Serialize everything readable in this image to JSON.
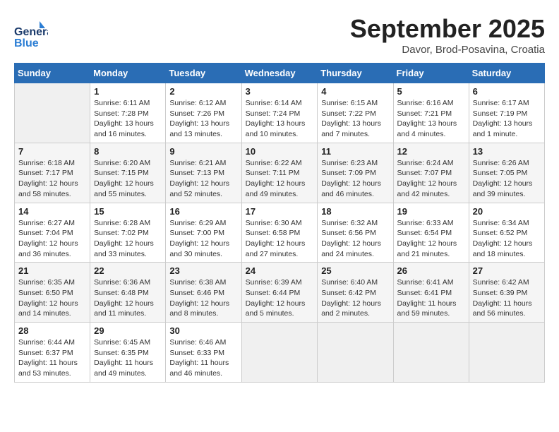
{
  "logo": {
    "general": "General",
    "blue": "Blue"
  },
  "header": {
    "month": "September 2025",
    "location": "Davor, Brod-Posavina, Croatia"
  },
  "days_of_week": [
    "Sunday",
    "Monday",
    "Tuesday",
    "Wednesday",
    "Thursday",
    "Friday",
    "Saturday"
  ],
  "weeks": [
    [
      {
        "day": "",
        "info": ""
      },
      {
        "day": "1",
        "info": "Sunrise: 6:11 AM\nSunset: 7:28 PM\nDaylight: 13 hours\nand 16 minutes."
      },
      {
        "day": "2",
        "info": "Sunrise: 6:12 AM\nSunset: 7:26 PM\nDaylight: 13 hours\nand 13 minutes."
      },
      {
        "day": "3",
        "info": "Sunrise: 6:14 AM\nSunset: 7:24 PM\nDaylight: 13 hours\nand 10 minutes."
      },
      {
        "day": "4",
        "info": "Sunrise: 6:15 AM\nSunset: 7:22 PM\nDaylight: 13 hours\nand 7 minutes."
      },
      {
        "day": "5",
        "info": "Sunrise: 6:16 AM\nSunset: 7:21 PM\nDaylight: 13 hours\nand 4 minutes."
      },
      {
        "day": "6",
        "info": "Sunrise: 6:17 AM\nSunset: 7:19 PM\nDaylight: 13 hours\nand 1 minute."
      }
    ],
    [
      {
        "day": "7",
        "info": "Sunrise: 6:18 AM\nSunset: 7:17 PM\nDaylight: 12 hours\nand 58 minutes."
      },
      {
        "day": "8",
        "info": "Sunrise: 6:20 AM\nSunset: 7:15 PM\nDaylight: 12 hours\nand 55 minutes."
      },
      {
        "day": "9",
        "info": "Sunrise: 6:21 AM\nSunset: 7:13 PM\nDaylight: 12 hours\nand 52 minutes."
      },
      {
        "day": "10",
        "info": "Sunrise: 6:22 AM\nSunset: 7:11 PM\nDaylight: 12 hours\nand 49 minutes."
      },
      {
        "day": "11",
        "info": "Sunrise: 6:23 AM\nSunset: 7:09 PM\nDaylight: 12 hours\nand 46 minutes."
      },
      {
        "day": "12",
        "info": "Sunrise: 6:24 AM\nSunset: 7:07 PM\nDaylight: 12 hours\nand 42 minutes."
      },
      {
        "day": "13",
        "info": "Sunrise: 6:26 AM\nSunset: 7:05 PM\nDaylight: 12 hours\nand 39 minutes."
      }
    ],
    [
      {
        "day": "14",
        "info": "Sunrise: 6:27 AM\nSunset: 7:04 PM\nDaylight: 12 hours\nand 36 minutes."
      },
      {
        "day": "15",
        "info": "Sunrise: 6:28 AM\nSunset: 7:02 PM\nDaylight: 12 hours\nand 33 minutes."
      },
      {
        "day": "16",
        "info": "Sunrise: 6:29 AM\nSunset: 7:00 PM\nDaylight: 12 hours\nand 30 minutes."
      },
      {
        "day": "17",
        "info": "Sunrise: 6:30 AM\nSunset: 6:58 PM\nDaylight: 12 hours\nand 27 minutes."
      },
      {
        "day": "18",
        "info": "Sunrise: 6:32 AM\nSunset: 6:56 PM\nDaylight: 12 hours\nand 24 minutes."
      },
      {
        "day": "19",
        "info": "Sunrise: 6:33 AM\nSunset: 6:54 PM\nDaylight: 12 hours\nand 21 minutes."
      },
      {
        "day": "20",
        "info": "Sunrise: 6:34 AM\nSunset: 6:52 PM\nDaylight: 12 hours\nand 18 minutes."
      }
    ],
    [
      {
        "day": "21",
        "info": "Sunrise: 6:35 AM\nSunset: 6:50 PM\nDaylight: 12 hours\nand 14 minutes."
      },
      {
        "day": "22",
        "info": "Sunrise: 6:36 AM\nSunset: 6:48 PM\nDaylight: 12 hours\nand 11 minutes."
      },
      {
        "day": "23",
        "info": "Sunrise: 6:38 AM\nSunset: 6:46 PM\nDaylight: 12 hours\nand 8 minutes."
      },
      {
        "day": "24",
        "info": "Sunrise: 6:39 AM\nSunset: 6:44 PM\nDaylight: 12 hours\nand 5 minutes."
      },
      {
        "day": "25",
        "info": "Sunrise: 6:40 AM\nSunset: 6:42 PM\nDaylight: 12 hours\nand 2 minutes."
      },
      {
        "day": "26",
        "info": "Sunrise: 6:41 AM\nSunset: 6:41 PM\nDaylight: 11 hours\nand 59 minutes."
      },
      {
        "day": "27",
        "info": "Sunrise: 6:42 AM\nSunset: 6:39 PM\nDaylight: 11 hours\nand 56 minutes."
      }
    ],
    [
      {
        "day": "28",
        "info": "Sunrise: 6:44 AM\nSunset: 6:37 PM\nDaylight: 11 hours\nand 53 minutes."
      },
      {
        "day": "29",
        "info": "Sunrise: 6:45 AM\nSunset: 6:35 PM\nDaylight: 11 hours\nand 49 minutes."
      },
      {
        "day": "30",
        "info": "Sunrise: 6:46 AM\nSunset: 6:33 PM\nDaylight: 11 hours\nand 46 minutes."
      },
      {
        "day": "",
        "info": ""
      },
      {
        "day": "",
        "info": ""
      },
      {
        "day": "",
        "info": ""
      },
      {
        "day": "",
        "info": ""
      }
    ]
  ]
}
